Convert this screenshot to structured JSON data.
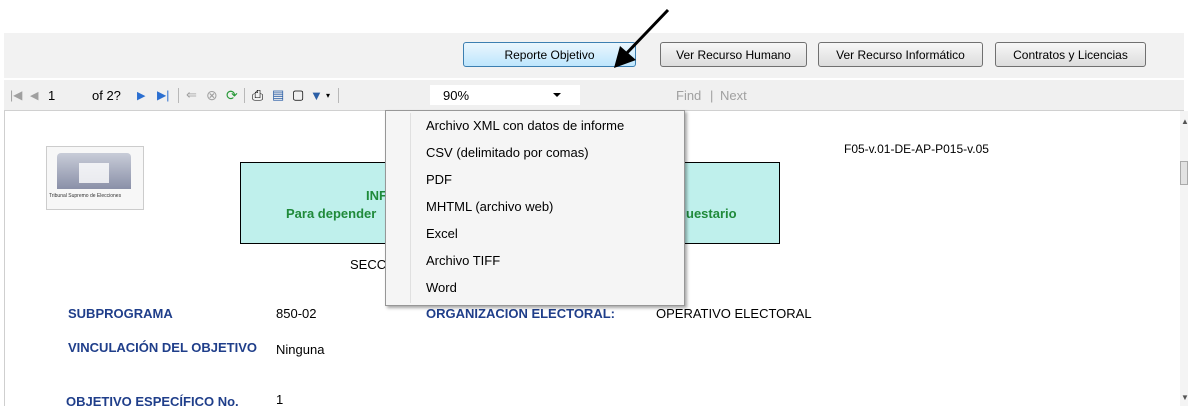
{
  "top_buttons": [
    {
      "label": "Reporte Objetivo"
    },
    {
      "label": "Ver Recurso Humano"
    },
    {
      "label": "Ver Recurso Informático"
    },
    {
      "label": "Contratos y Licencias"
    }
  ],
  "toolbar": {
    "page_current": "1",
    "page_of": "of 2?",
    "zoom": "90%",
    "find_label": "Find",
    "separator": "|",
    "next_label": "Next"
  },
  "export_menu": {
    "items": [
      "Archivo XML con datos de informe",
      "CSV (delimitado por comas)",
      "PDF",
      "MHTML (archivo web)",
      "Excel",
      "Archivo TIFF",
      "Word"
    ]
  },
  "report": {
    "logo_caption": "Tribunal Supremo de Elecciones",
    "form_code": "F05-v.01-DE-AP-P015-v.05",
    "title_line1": "INF",
    "title_line2": "Para depender",
    "title_line2_end": "uestario",
    "section": "SECC",
    "fields": [
      {
        "label": "SUBPROGRAMA",
        "value": "850-02"
      },
      {
        "label": "ORGANIZACION ELECTORAL:",
        "value": "OPERATIVO ELECTORAL"
      },
      {
        "label": "VINCULACIÓN DEL OBJETIVO",
        "value": "Ninguna"
      },
      {
        "label": "OBJETIVO ESPECÍFICO No.",
        "value": "1"
      }
    ]
  }
}
